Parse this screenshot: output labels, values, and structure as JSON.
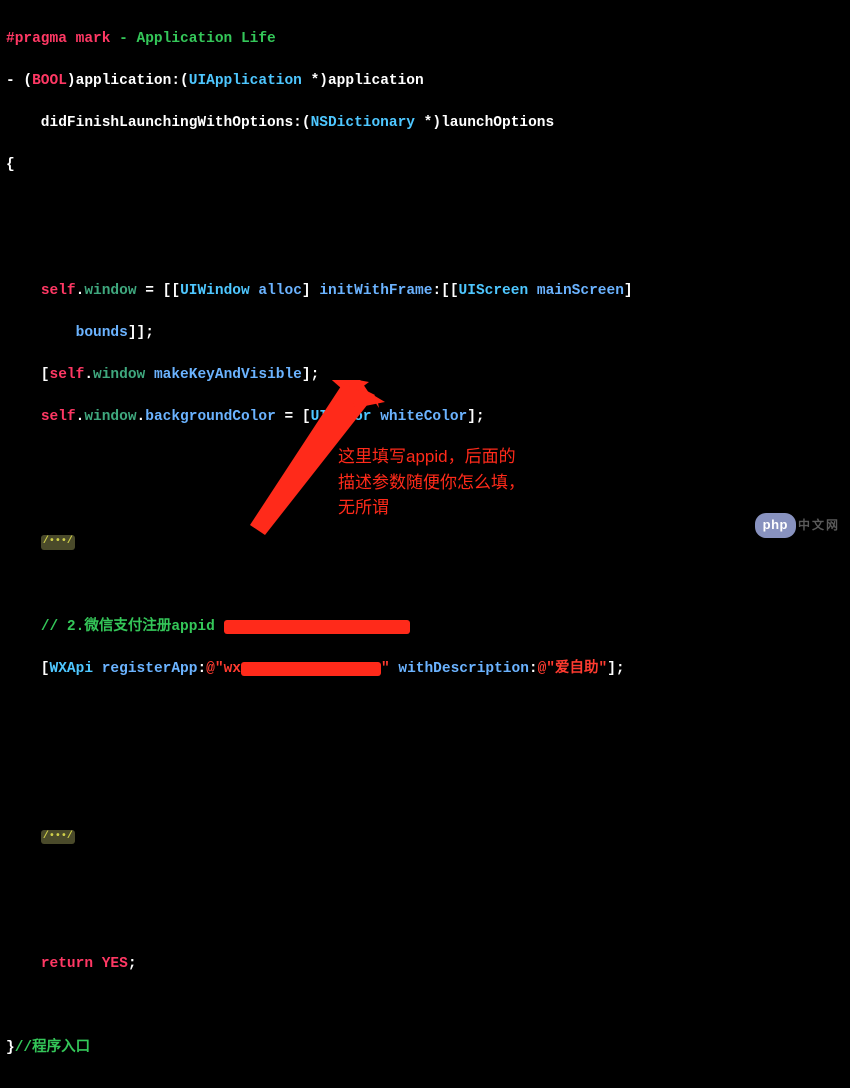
{
  "code": {
    "l1_a": "#pragma mark",
    "l1_b": " - Application Life",
    "l2_a": "- (",
    "l2_b": "BOOL",
    "l2_c": ")application:(",
    "l2_d": "UIApplication",
    "l2_e": " *)application",
    "l3_a": "    didFinishLaunchingWithOptions:(",
    "l3_b": "NSDictionary",
    "l3_c": " *)launchOptions",
    "l4": "{",
    "l5_a": "    ",
    "l5_b": "self",
    "l5_c": ".",
    "l5_d": "window",
    "l5_e": " = [[",
    "l5_f": "UIWindow",
    "l5_g": " ",
    "l5_h": "alloc",
    "l5_i": "] ",
    "l5_j": "initWithFrame",
    "l5_k": ":[[",
    "l5_l": "UIScreen",
    "l5_m": " ",
    "l5_n": "mainScreen",
    "l5_o": "]",
    "l6_a": "        ",
    "l6_b": "bounds",
    "l6_c": "]];",
    "l7_a": "    [",
    "l7_b": "self",
    "l7_c": ".",
    "l7_d": "window",
    "l7_e": " ",
    "l7_f": "makeKeyAndVisible",
    "l7_g": "];",
    "l8_a": "    ",
    "l8_b": "self",
    "l8_c": ".",
    "l8_d": "window",
    "l8_e": ".",
    "l8_f": "backgroundColor",
    "l8_g": " = [",
    "l8_h": "UIColor",
    "l8_i": " ",
    "l8_j": "whiteColor",
    "l8_k": "];",
    "fold": "/•••/",
    "c1": "// 2.微信支付注册appid ",
    "l9_a": "    [",
    "l9_b": "WXApi",
    "l9_c": " ",
    "l9_d": "registerApp",
    "l9_e": ":",
    "l9_f": "@\"",
    "l9_g": "wx",
    "l9_h": "\"",
    "l9_i": " ",
    "l9_j": "withDescription",
    "l9_k": ":",
    "l9_l": "@\"爱自助\"",
    "l9_m": "];",
    "ret_a": "    ",
    "ret_b": "return",
    "ret_c": " ",
    "ret_d": "YES",
    "ret_e": ";",
    "end_a": "}",
    "end_b": "//程序入口"
  },
  "annotation": {
    "line1": "这里填写appid，后面的",
    "line2": "描述参数随便你怎么填，",
    "line3": "无所谓"
  },
  "watermark": {
    "badge": "php",
    "text": "中文网"
  }
}
